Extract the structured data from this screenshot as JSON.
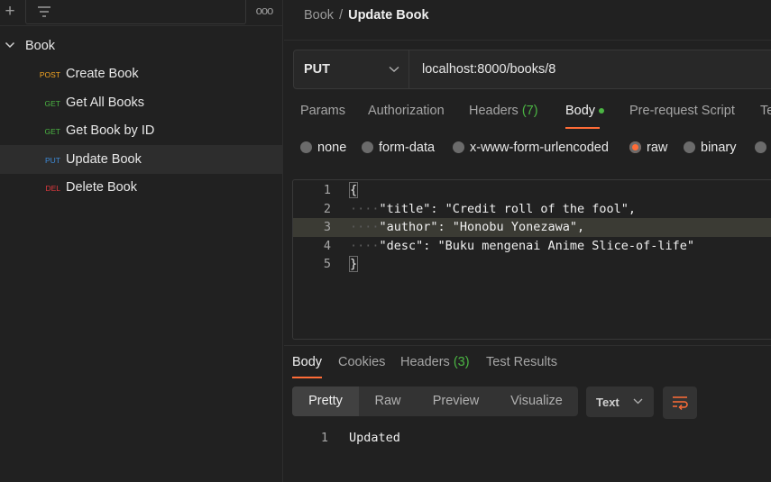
{
  "sidebar": {
    "add_label": "+",
    "more_label": "ooo",
    "collection": {
      "name": "Book"
    },
    "requests": [
      {
        "method": "POST",
        "method_color": "#f5a623",
        "name": "Create Book",
        "active": false
      },
      {
        "method": "GET",
        "method_color": "#4bb543",
        "name": "Get All Books",
        "active": false
      },
      {
        "method": "GET",
        "method_color": "#4bb543",
        "name": "Get Book by ID",
        "active": false
      },
      {
        "method": "PUT",
        "method_color": "#3d8bd9",
        "name": "Update Book",
        "active": true
      },
      {
        "method": "DEL",
        "method_color": "#e0393e",
        "name": "Delete Book",
        "active": false
      }
    ]
  },
  "breadcrumb": {
    "parent": "Book",
    "separator": "/",
    "current": "Update Book"
  },
  "request": {
    "method": "PUT",
    "url": "localhost:8000/books/8"
  },
  "request_tabs": [
    {
      "label": "Params",
      "count": ""
    },
    {
      "label": "Authorization",
      "count": ""
    },
    {
      "label": "Headers",
      "count": "(7)"
    },
    {
      "label": "Body",
      "count": "",
      "active": true
    },
    {
      "label": "Pre-request Script",
      "count": ""
    },
    {
      "label": "Te",
      "count": ""
    }
  ],
  "body_types": [
    {
      "label": "none",
      "selected": false
    },
    {
      "label": "form-data",
      "selected": false
    },
    {
      "label": "x-www-form-urlencoded",
      "selected": false
    },
    {
      "label": "raw",
      "selected": true
    },
    {
      "label": "binary",
      "selected": false
    },
    {
      "label": "",
      "selected": false
    }
  ],
  "editor": {
    "lines": [
      {
        "n": "1",
        "text": "{"
      },
      {
        "n": "2",
        "text": "\"title\": \"Credit roll of the fool\","
      },
      {
        "n": "3",
        "text": "\"author\": \"Honobu Yonezawa\","
      },
      {
        "n": "4",
        "text": "\"desc\": \"Buku mengenai Anime Slice-of-life\""
      },
      {
        "n": "5",
        "text": "}"
      }
    ],
    "highlighted_line": 3
  },
  "response_tabs": [
    {
      "label": "Body",
      "count": "",
      "active": true
    },
    {
      "label": "Cookies",
      "count": ""
    },
    {
      "label": "Headers",
      "count": "(3)"
    },
    {
      "label": "Test Results",
      "count": ""
    }
  ],
  "view_modes": [
    "Pretty",
    "Raw",
    "Preview",
    "Visualize"
  ],
  "active_view_mode": "Pretty",
  "response_language": "Text",
  "response": {
    "line_number": "1",
    "text": "Updated"
  },
  "colors": {
    "accent": "#ff6c37",
    "count_green": "#4bb543"
  }
}
